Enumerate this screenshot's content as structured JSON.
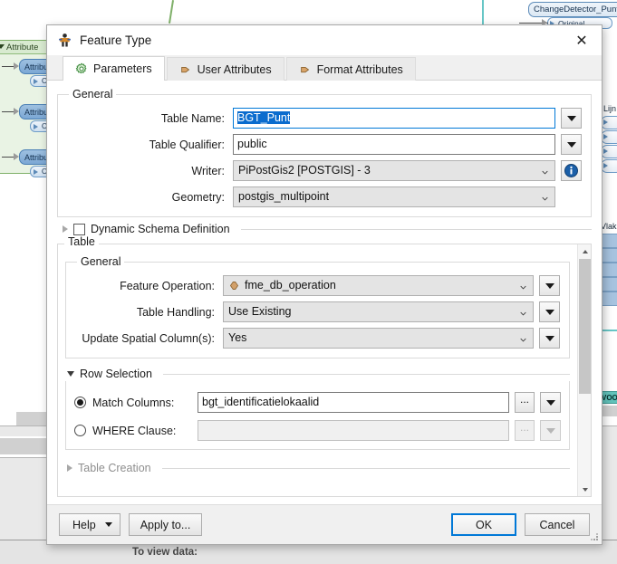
{
  "background": {
    "bookmark_label": "Attribute",
    "left_nodes": [
      {
        "label": "Attribu",
        "port": "Ou"
      },
      {
        "label": "Attribu",
        "port": "Ou"
      },
      {
        "label": "Attribu",
        "port": "Ou"
      }
    ],
    "top_right_node": {
      "label": "ChangeDetector_Punt",
      "port": "Original"
    },
    "right_labels": {
      "lijn": "Lijn",
      "vlak": "Vlak",
      "voo": "VOO"
    },
    "footer_text": "To view data:"
  },
  "dialog": {
    "title": "Feature Type",
    "title_icon": "fme-feature-type-icon",
    "close_icon": "close-icon",
    "tabs": [
      {
        "label": "Parameters",
        "icon": "gear-icon",
        "active": true
      },
      {
        "label": "User Attributes",
        "icon": "arrow-right-icon",
        "active": false
      },
      {
        "label": "Format Attributes",
        "icon": "arrow-right-icon",
        "active": false
      }
    ],
    "general": {
      "legend": "General",
      "table_name": {
        "label": "Table Name:",
        "value": "BGT_Punt",
        "selected": true,
        "dropdown_icon": "triangle-down-icon"
      },
      "table_qualifier": {
        "label": "Table Qualifier:",
        "value": "public",
        "dropdown_icon": "triangle-down-icon"
      },
      "writer": {
        "label": "Writer:",
        "value": "PiPostGis2 [POSTGIS] - 3",
        "info_icon": "info-icon"
      },
      "geometry": {
        "label": "Geometry:",
        "value": "postgis_multipoint"
      },
      "dynamic_schema": {
        "label": "Dynamic Schema Definition",
        "checked": false,
        "expander_icon": "chevron-right-icon"
      }
    },
    "table": {
      "legend": "Table",
      "general": {
        "legend": "General",
        "feature_operation": {
          "label": "Feature Operation:",
          "value": "fme_db_operation",
          "value_icon": "attribute-arrow-icon"
        },
        "table_handling": {
          "label": "Table Handling:",
          "value": "Use Existing"
        },
        "update_spatial_columns": {
          "label": "Update Spatial Column(s):",
          "value": "Yes"
        }
      },
      "row_selection": {
        "legend": "Row Selection",
        "expander_icon": "chevron-down-icon",
        "match_columns": {
          "label": "Match Columns:",
          "value": "bgt_identificatielokaalid",
          "selected": true,
          "ellipsis": "...",
          "enabled": true
        },
        "where_clause": {
          "label": "WHERE Clause:",
          "value": "",
          "selected": false,
          "ellipsis": "...",
          "enabled": false
        }
      },
      "table_creation": {
        "label": "Table Creation",
        "expander_icon": "chevron-right-icon"
      }
    },
    "buttons": {
      "help": "Help",
      "help_dropdown_icon": "triangle-down-icon",
      "apply_to": "Apply to...",
      "ok": "OK",
      "cancel": "Cancel"
    },
    "scrollbar": {
      "up_icon": "chevron-up-icon",
      "down_icon": "chevron-down-icon"
    }
  },
  "colors": {
    "accent": "#0078d7",
    "selection": "#0a6cce",
    "dialog_bg": "#f0f0f0",
    "bookmark_green": "#e9f3e4",
    "node_blue": "#7ba7d4",
    "teal": "#62c3bb"
  }
}
